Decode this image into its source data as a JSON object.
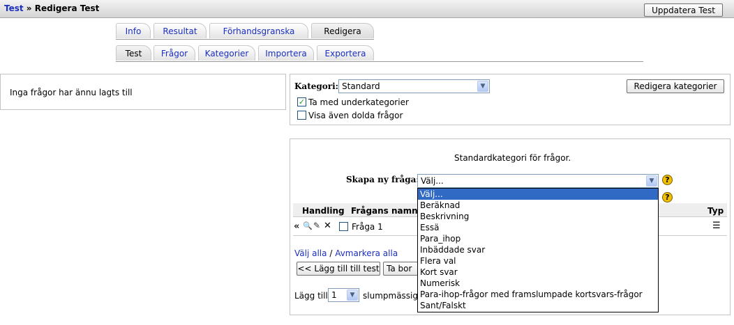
{
  "navbar": {
    "breadcrumb_link": "Test",
    "breadcrumb_sep": "»",
    "breadcrumb_current": "Redigera Test",
    "update_button": "Uppdatera Test"
  },
  "tabs_row1": [
    "Info",
    "Resultat",
    "Förhandsgranska",
    "Redigera"
  ],
  "tabs_row2": [
    "Test",
    "Frågor",
    "Kategorier",
    "Importera",
    "Exportera"
  ],
  "left_panel": {
    "message": "Inga frågor har ännu lagts till"
  },
  "category": {
    "label": "Kategori:",
    "selected": "Standard",
    "edit_button": "Redigera kategorier",
    "include_sub_label": "Ta med underkategorier",
    "include_sub_checked": true,
    "show_hidden_label": "Visa även dolda frågor",
    "show_hidden_checked": false
  },
  "questions": {
    "description": "Standardkategori för frågor.",
    "create_label": "Skapa ny fråga:",
    "create_selected": "Välj...",
    "table_headers": {
      "action": "Handling",
      "name": "Frågans namn",
      "type": "Typ"
    },
    "rows": [
      {
        "name": "Fråga 1"
      }
    ],
    "select_all": "Välj alla",
    "separator": "/",
    "deselect_all": "Avmarkera alla",
    "add_to_quiz_button": "<< Lägg till till test",
    "delete_button_partial": "Ta bor",
    "add_label": "Lägg till",
    "random_count": "1",
    "random_text_partial": "slumpmässig"
  },
  "dropdown_options": [
    "Välj...",
    "Beräknad",
    "Beskrivning",
    "Essä",
    "Para_ihop",
    "Inbäddade svar",
    "Flera val",
    "Kort svar",
    "Numerisk",
    "Para-ihop-frågor med framslumpade kortsvars-frågor",
    "Sant/Falskt"
  ],
  "icons": {
    "move": "double-left-arrow-icon",
    "preview": "magnifier-icon",
    "edit": "pencil-icon",
    "delete": "cross-icon",
    "help": "help-icon",
    "qtype": "multichoice-icon"
  },
  "colors": {
    "link": "#1b2fbf",
    "selection": "#316ac5",
    "help": "#f0c000"
  }
}
